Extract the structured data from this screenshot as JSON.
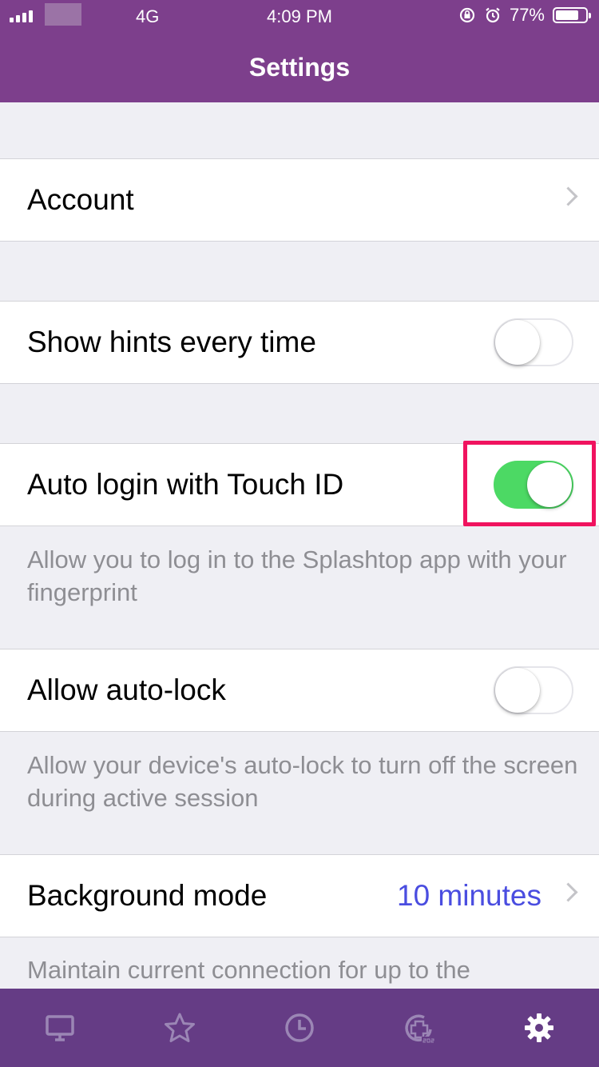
{
  "status_bar": {
    "network": "4G",
    "time": "4:09 PM",
    "battery": "77%",
    "battery_level": 0.77,
    "icons": [
      "signal-icon",
      "rotation-lock-icon",
      "alarm-icon",
      "battery-icon"
    ]
  },
  "nav": {
    "title": "Settings"
  },
  "cells": {
    "account": {
      "label": "Account"
    },
    "show_hints": {
      "label": "Show hints every time",
      "on": false
    },
    "auto_login": {
      "label": "Auto login with Touch ID",
      "on": true,
      "footnote": "Allow you to log in to the Splashtop app with your fingerprint"
    },
    "auto_lock": {
      "label": "Allow auto-lock",
      "on": false,
      "footnote": "Allow your device's auto-lock to turn off the screen during active session"
    },
    "background_mode": {
      "label": "Background mode",
      "value": "10 minutes",
      "footnote": "Maintain current connection for up to the"
    }
  },
  "tabbar": {
    "items": [
      {
        "icon": "monitor-icon",
        "active": false
      },
      {
        "icon": "star-icon",
        "active": false
      },
      {
        "icon": "clock-icon",
        "active": false
      },
      {
        "icon": "sos-icon",
        "active": false
      },
      {
        "icon": "gear-icon",
        "active": true
      }
    ],
    "inactive_color": "#9b86b5",
    "active_color": "#ffffff"
  },
  "colors": {
    "header": "#7d3f8c",
    "tabbar": "#653c85",
    "toggle_on": "#4cd964",
    "highlight": "#f0135f",
    "value_text": "#4a4de0"
  }
}
